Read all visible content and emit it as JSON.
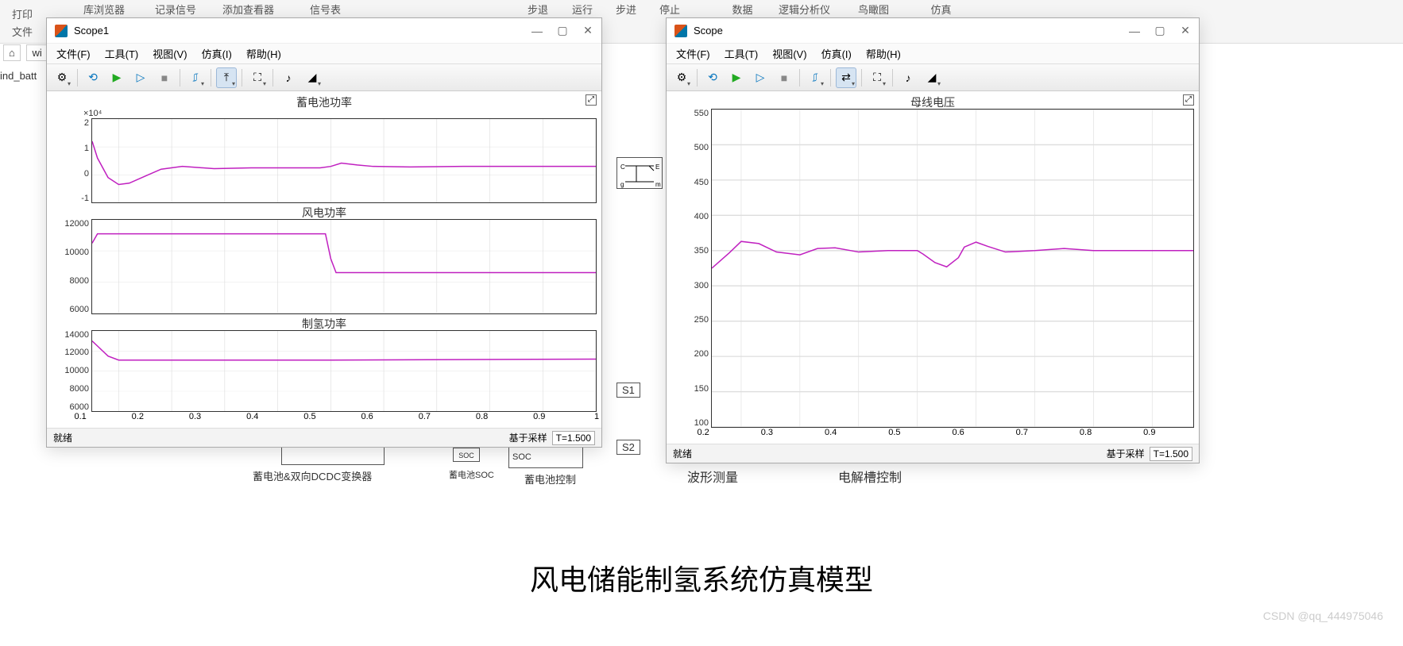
{
  "background": {
    "toolbar_items": {
      "a": "库浏览器",
      "b": "记录信号",
      "c": "添加查看器",
      "d": "信号表",
      "e": "步退",
      "f": "运行",
      "g": "步进",
      "h": "停止",
      "i": "数据\n检查器",
      "j": "逻辑分析仪",
      "k": "鸟瞰图",
      "l": "仿真\n管理器"
    },
    "print": "打印",
    "file": "文件",
    "nav": "wi",
    "model": "ind_batt",
    "big_title": "风电储能制氢系统仿真模型",
    "block1": "蓄电池&双向DCDC变换器",
    "block2": "蓄电池SOC",
    "block3": "蓄电池控制",
    "block4": "波形测量",
    "block5": "电解槽控制",
    "soc": "SOC",
    "s1": "S1",
    "s2": "S2",
    "watermark": "CSDN @qq_444975046"
  },
  "scope1": {
    "title": "Scope1",
    "menus": {
      "file": "文件(F)",
      "tools": "工具(T)",
      "view": "视图(V)",
      "sim": "仿真(I)",
      "help": "帮助(H)"
    },
    "status": {
      "ready": "就绪",
      "sample": "基于采样",
      "t": "T=1.500"
    },
    "y_exp": "×10⁴",
    "highlight": "⤢"
  },
  "scope2": {
    "title": "Scope",
    "menus": {
      "file": "文件(F)",
      "tools": "工具(T)",
      "view": "视图(V)",
      "sim": "仿真(I)",
      "help": "帮助(H)"
    },
    "status": {
      "ready": "就绪",
      "sample": "基于采样",
      "t": "T=1.500"
    },
    "highlight": "⤢"
  },
  "chart_data": [
    {
      "type": "line",
      "window": "Scope1",
      "title": "蓄电池功率",
      "xlabel": "",
      "ylabel": "",
      "y_multiplier": "×10^4",
      "xlim": [
        0.05,
        1.0
      ],
      "ylim": [
        -1,
        2
      ],
      "y_ticks": [
        -1,
        0,
        1,
        2
      ],
      "x_ticks": [
        0.1,
        0.2,
        0.3,
        0.4,
        0.5,
        0.6,
        0.7,
        0.8,
        0.9,
        1.0
      ],
      "series": [
        {
          "name": "battery_power",
          "color": "#c020c0",
          "x": [
            0.05,
            0.06,
            0.08,
            0.1,
            0.12,
            0.15,
            0.18,
            0.22,
            0.28,
            0.35,
            0.48,
            0.5,
            0.52,
            0.55,
            0.58,
            0.65,
            0.75,
            0.85,
            1.0
          ],
          "values": [
            1.2,
            0.6,
            -0.1,
            -0.35,
            -0.3,
            -0.05,
            0.2,
            0.3,
            0.22,
            0.25,
            0.25,
            0.3,
            0.42,
            0.35,
            0.3,
            0.28,
            0.3,
            0.3,
            0.3
          ]
        }
      ]
    },
    {
      "type": "line",
      "window": "Scope1",
      "title": "风电功率",
      "xlabel": "",
      "ylabel": "",
      "xlim": [
        0.05,
        1.0
      ],
      "ylim": [
        6000,
        12000
      ],
      "y_ticks": [
        6000,
        8000,
        10000,
        12000
      ],
      "x_ticks": [
        0.1,
        0.2,
        0.3,
        0.4,
        0.5,
        0.6,
        0.7,
        0.8,
        0.9,
        1.0
      ],
      "series": [
        {
          "name": "wind_power",
          "color": "#c020c0",
          "x": [
            0.05,
            0.06,
            0.49,
            0.5,
            0.51,
            1.0
          ],
          "values": [
            10500,
            11100,
            11100,
            9500,
            8600,
            8600
          ]
        }
      ]
    },
    {
      "type": "line",
      "window": "Scope1",
      "title": "制氢功率",
      "xlabel": "",
      "ylabel": "",
      "xlim": [
        0.05,
        1.0
      ],
      "ylim": [
        6000,
        14000
      ],
      "y_ticks": [
        6000,
        8000,
        10000,
        12000,
        14000
      ],
      "x_ticks": [
        0.1,
        0.2,
        0.3,
        0.4,
        0.5,
        0.6,
        0.7,
        0.8,
        0.9,
        1.0
      ],
      "series": [
        {
          "name": "h2_power",
          "color": "#c020c0",
          "x": [
            0.05,
            0.06,
            0.08,
            0.1,
            0.15,
            0.5,
            1.0
          ],
          "values": [
            13000,
            12500,
            11500,
            11100,
            11100,
            11100,
            11200
          ]
        }
      ]
    },
    {
      "type": "line",
      "window": "Scope",
      "title": "母线电压",
      "xlabel": "",
      "ylabel": "",
      "xlim": [
        0.15,
        0.97
      ],
      "ylim": [
        100,
        550
      ],
      "y_ticks": [
        100,
        150,
        200,
        250,
        300,
        350,
        400,
        450,
        500,
        550
      ],
      "x_ticks": [
        0.2,
        0.3,
        0.4,
        0.5,
        0.6,
        0.7,
        0.8,
        0.9
      ],
      "series": [
        {
          "name": "bus_voltage",
          "color": "#c020c0",
          "x": [
            0.15,
            0.18,
            0.2,
            0.23,
            0.26,
            0.3,
            0.33,
            0.36,
            0.4,
            0.45,
            0.5,
            0.51,
            0.53,
            0.55,
            0.57,
            0.58,
            0.6,
            0.62,
            0.65,
            0.7,
            0.75,
            0.8,
            0.9,
            0.97
          ],
          "values": [
            325,
            347,
            363,
            360,
            348,
            344,
            353,
            354,
            348,
            350,
            350,
            345,
            333,
            327,
            340,
            355,
            362,
            356,
            348,
            350,
            353,
            350,
            350,
            350
          ]
        }
      ]
    }
  ]
}
